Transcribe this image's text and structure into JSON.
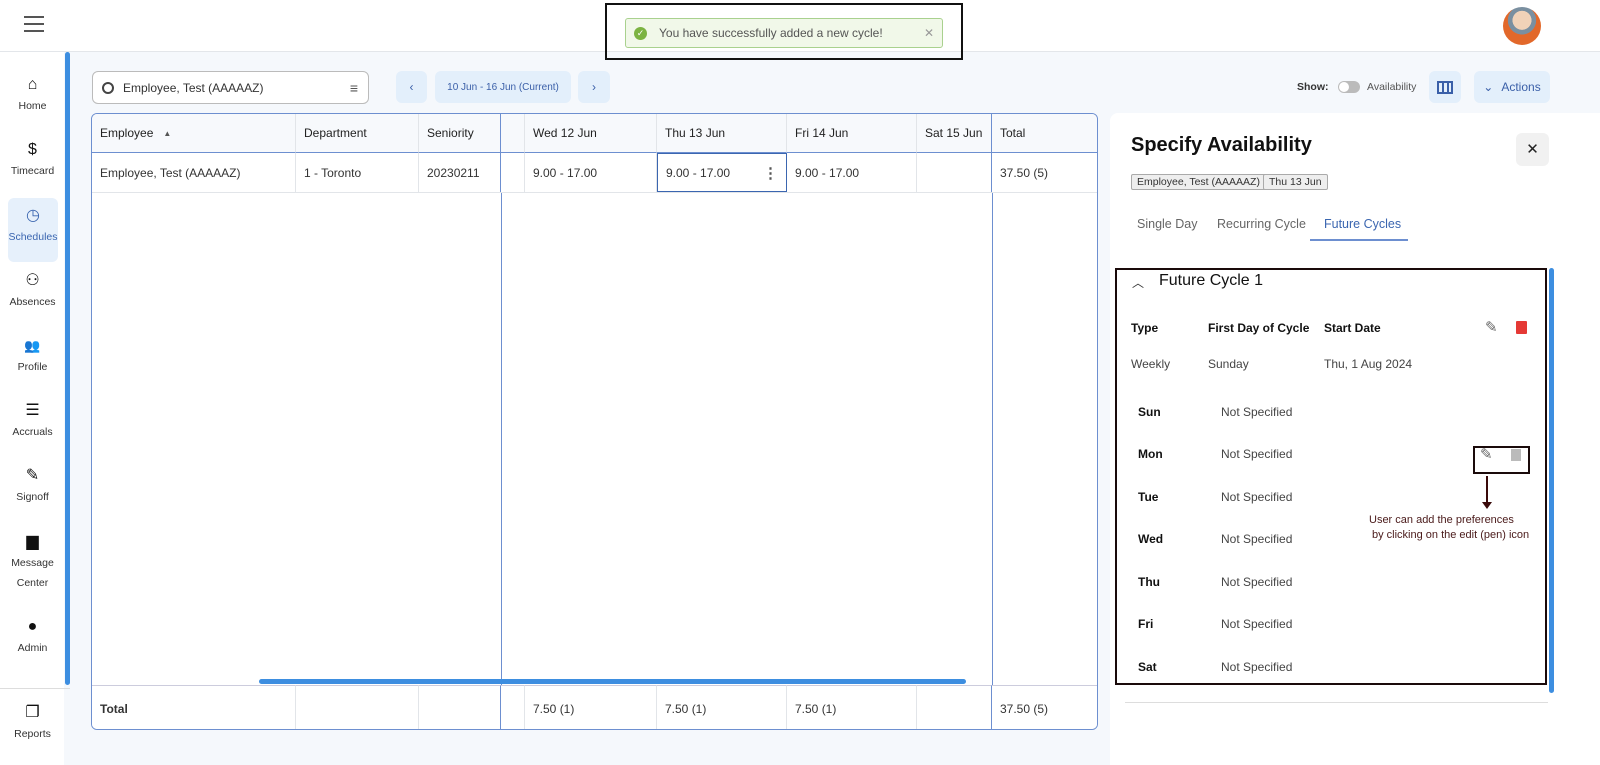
{
  "toast": {
    "message": "You have successfully added a new cycle!",
    "close": "✕"
  },
  "sidebar": {
    "items": [
      {
        "label": "Home",
        "icon": "⌂"
      },
      {
        "label": "Timecard",
        "icon": "$"
      },
      {
        "label": "Schedules",
        "icon": "◷"
      },
      {
        "label": "Absences",
        "icon": "⚇"
      },
      {
        "label": "Profile",
        "icon": "👥"
      },
      {
        "label": "Accruals",
        "icon": "☰"
      },
      {
        "label": "Signoff",
        "icon": "✎"
      },
      {
        "label": "Message",
        "label2": "Center",
        "icon": "▆"
      },
      {
        "label": "Admin",
        "icon": "●"
      },
      {
        "label": "Reports",
        "icon": "❐"
      }
    ]
  },
  "toolbar": {
    "search_value": "Employee, Test (AAAAAZ)",
    "date_range": "10 Jun - 16 Jun (Current)",
    "show_label": "Show:",
    "availability_label": "Availability",
    "availability_on": false,
    "actions_label": "Actions"
  },
  "table": {
    "headers": [
      "Employee",
      "Department",
      "Seniority",
      "",
      "Wed 12 Jun",
      "Thu 13 Jun",
      "Fri 14 Jun",
      "Sat 15 Jun",
      "Total"
    ],
    "rows": [
      [
        "Employee, Test (AAAAAZ)",
        "1 - Toronto",
        "20230211",
        "",
        "9.00 - 17.00",
        "9.00 - 17.00",
        "9.00 - 17.00",
        "",
        "37.50 (5)"
      ]
    ],
    "footer": [
      "Total",
      "",
      "",
      "",
      "7.50 (1)",
      "7.50 (1)",
      "7.50 (1)",
      "",
      "37.50 (5)"
    ]
  },
  "panel": {
    "title": "Specify Availability",
    "chips": [
      "Employee, Test (AAAAAZ)",
      "Thu 13 Jun"
    ],
    "tabs": [
      "Single Day",
      "Recurring Cycle",
      "Future Cycles"
    ],
    "active_tab": "Future Cycles",
    "cycle": {
      "title": "Future Cycle 1",
      "headers": [
        "Type",
        "First Day of Cycle",
        "Start Date"
      ],
      "values": [
        "Weekly",
        "Sunday",
        "Thu, 1 Aug 2024"
      ],
      "days": [
        {
          "day": "Sun",
          "value": "Not Specified"
        },
        {
          "day": "Mon",
          "value": "Not Specified"
        },
        {
          "day": "Tue",
          "value": "Not Specified"
        },
        {
          "day": "Wed",
          "value": "Not Specified"
        },
        {
          "day": "Thu",
          "value": "Not Specified"
        },
        {
          "day": "Fri",
          "value": "Not Specified"
        },
        {
          "day": "Sat",
          "value": "Not Specified"
        }
      ]
    },
    "annotation": [
      "User can add the preferences",
      "by clicking on the edit (pen) icon"
    ]
  },
  "colors": {
    "accent": "#3b66b0",
    "scrollbar": "#3d8ee0",
    "delete": "#e53935",
    "toast_bg": "#f1f8e9"
  }
}
